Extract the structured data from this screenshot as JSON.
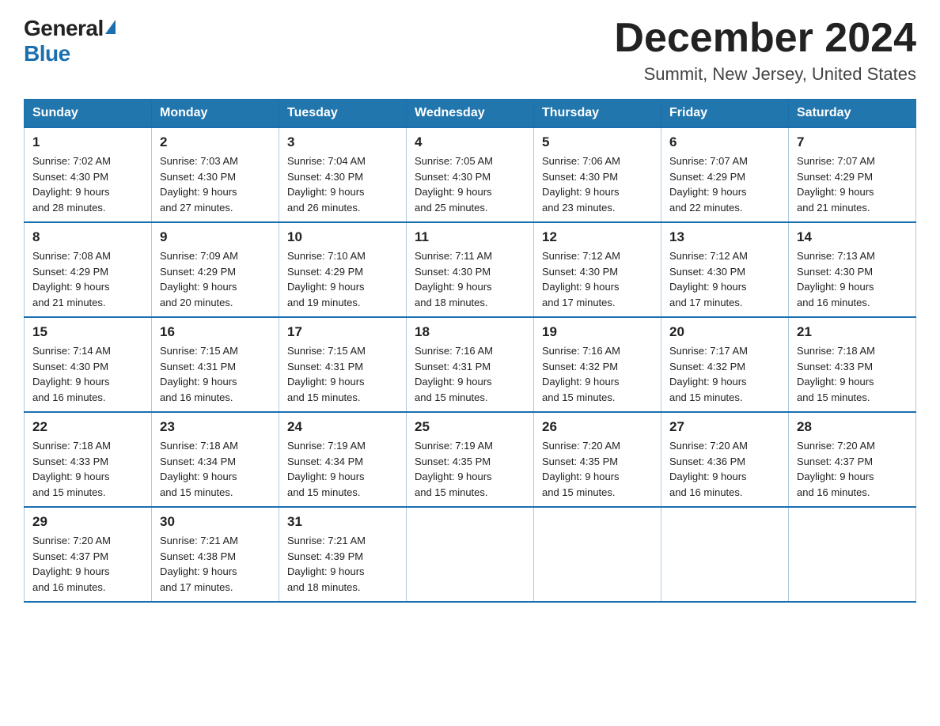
{
  "logo": {
    "general": "General",
    "blue": "Blue"
  },
  "title": "December 2024",
  "location": "Summit, New Jersey, United States",
  "days_of_week": [
    "Sunday",
    "Monday",
    "Tuesday",
    "Wednesday",
    "Thursday",
    "Friday",
    "Saturday"
  ],
  "weeks": [
    [
      {
        "day": "1",
        "sunrise": "7:02 AM",
        "sunset": "4:30 PM",
        "daylight": "9 hours and 28 minutes."
      },
      {
        "day": "2",
        "sunrise": "7:03 AM",
        "sunset": "4:30 PM",
        "daylight": "9 hours and 27 minutes."
      },
      {
        "day": "3",
        "sunrise": "7:04 AM",
        "sunset": "4:30 PM",
        "daylight": "9 hours and 26 minutes."
      },
      {
        "day": "4",
        "sunrise": "7:05 AM",
        "sunset": "4:30 PM",
        "daylight": "9 hours and 25 minutes."
      },
      {
        "day": "5",
        "sunrise": "7:06 AM",
        "sunset": "4:30 PM",
        "daylight": "9 hours and 23 minutes."
      },
      {
        "day": "6",
        "sunrise": "7:07 AM",
        "sunset": "4:29 PM",
        "daylight": "9 hours and 22 minutes."
      },
      {
        "day": "7",
        "sunrise": "7:07 AM",
        "sunset": "4:29 PM",
        "daylight": "9 hours and 21 minutes."
      }
    ],
    [
      {
        "day": "8",
        "sunrise": "7:08 AM",
        "sunset": "4:29 PM",
        "daylight": "9 hours and 21 minutes."
      },
      {
        "day": "9",
        "sunrise": "7:09 AM",
        "sunset": "4:29 PM",
        "daylight": "9 hours and 20 minutes."
      },
      {
        "day": "10",
        "sunrise": "7:10 AM",
        "sunset": "4:29 PM",
        "daylight": "9 hours and 19 minutes."
      },
      {
        "day": "11",
        "sunrise": "7:11 AM",
        "sunset": "4:30 PM",
        "daylight": "9 hours and 18 minutes."
      },
      {
        "day": "12",
        "sunrise": "7:12 AM",
        "sunset": "4:30 PM",
        "daylight": "9 hours and 17 minutes."
      },
      {
        "day": "13",
        "sunrise": "7:12 AM",
        "sunset": "4:30 PM",
        "daylight": "9 hours and 17 minutes."
      },
      {
        "day": "14",
        "sunrise": "7:13 AM",
        "sunset": "4:30 PM",
        "daylight": "9 hours and 16 minutes."
      }
    ],
    [
      {
        "day": "15",
        "sunrise": "7:14 AM",
        "sunset": "4:30 PM",
        "daylight": "9 hours and 16 minutes."
      },
      {
        "day": "16",
        "sunrise": "7:15 AM",
        "sunset": "4:31 PM",
        "daylight": "9 hours and 16 minutes."
      },
      {
        "day": "17",
        "sunrise": "7:15 AM",
        "sunset": "4:31 PM",
        "daylight": "9 hours and 15 minutes."
      },
      {
        "day": "18",
        "sunrise": "7:16 AM",
        "sunset": "4:31 PM",
        "daylight": "9 hours and 15 minutes."
      },
      {
        "day": "19",
        "sunrise": "7:16 AM",
        "sunset": "4:32 PM",
        "daylight": "9 hours and 15 minutes."
      },
      {
        "day": "20",
        "sunrise": "7:17 AM",
        "sunset": "4:32 PM",
        "daylight": "9 hours and 15 minutes."
      },
      {
        "day": "21",
        "sunrise": "7:18 AM",
        "sunset": "4:33 PM",
        "daylight": "9 hours and 15 minutes."
      }
    ],
    [
      {
        "day": "22",
        "sunrise": "7:18 AM",
        "sunset": "4:33 PM",
        "daylight": "9 hours and 15 minutes."
      },
      {
        "day": "23",
        "sunrise": "7:18 AM",
        "sunset": "4:34 PM",
        "daylight": "9 hours and 15 minutes."
      },
      {
        "day": "24",
        "sunrise": "7:19 AM",
        "sunset": "4:34 PM",
        "daylight": "9 hours and 15 minutes."
      },
      {
        "day": "25",
        "sunrise": "7:19 AM",
        "sunset": "4:35 PM",
        "daylight": "9 hours and 15 minutes."
      },
      {
        "day": "26",
        "sunrise": "7:20 AM",
        "sunset": "4:35 PM",
        "daylight": "9 hours and 15 minutes."
      },
      {
        "day": "27",
        "sunrise": "7:20 AM",
        "sunset": "4:36 PM",
        "daylight": "9 hours and 16 minutes."
      },
      {
        "day": "28",
        "sunrise": "7:20 AM",
        "sunset": "4:37 PM",
        "daylight": "9 hours and 16 minutes."
      }
    ],
    [
      {
        "day": "29",
        "sunrise": "7:20 AM",
        "sunset": "4:37 PM",
        "daylight": "9 hours and 16 minutes."
      },
      {
        "day": "30",
        "sunrise": "7:21 AM",
        "sunset": "4:38 PM",
        "daylight": "9 hours and 17 minutes."
      },
      {
        "day": "31",
        "sunrise": "7:21 AM",
        "sunset": "4:39 PM",
        "daylight": "9 hours and 18 minutes."
      },
      null,
      null,
      null,
      null
    ]
  ]
}
